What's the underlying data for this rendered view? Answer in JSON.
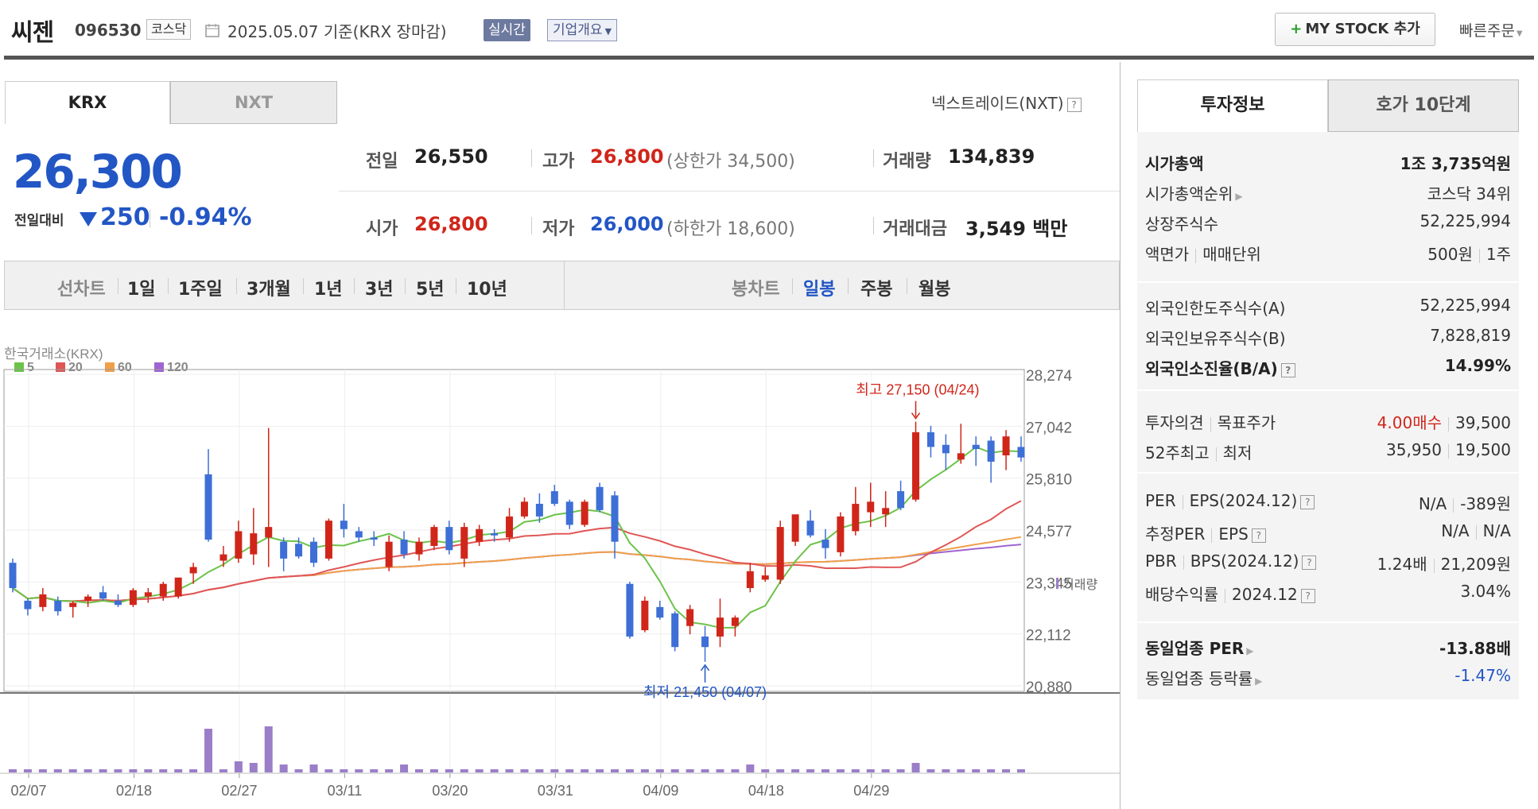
{
  "header": {
    "name": "씨젠",
    "code": "096530",
    "market": "코스닥",
    "date": "2025.05.07  기준(KRX 장마감)",
    "realtime": "실시간",
    "corp_overview": "기업개요",
    "my_stock": "MY STOCK 추가",
    "quick_order": "빠른주문"
  },
  "exchange": {
    "tabs": [
      "KRX",
      "NXT"
    ],
    "nxt_link": "넥스트레이드(NXT)"
  },
  "quote": {
    "price": "26,300",
    "change_label": "전일대비",
    "change": "250",
    "change_pct": "-0.94%",
    "prev_label": "전일",
    "prev": "26,550",
    "high_label": "고가",
    "high": "26,800",
    "upper_limit": "(상한가 34,500)",
    "volume_label": "거래량",
    "volume": "134,839",
    "open_label": "시가",
    "open": "26,800",
    "low_label": "저가",
    "low": "26,000",
    "lower_limit": "(하한가 18,600)",
    "amount_label": "거래대금",
    "amount": "3,549 백만"
  },
  "chart_bar": {
    "line_label": "선차트",
    "line_periods": [
      "1일",
      "1주일",
      "3개월",
      "1년",
      "3년",
      "5년",
      "10년"
    ],
    "candle_label": "봉차트",
    "candle_periods": [
      "일봉",
      "주봉",
      "월봉"
    ],
    "selected": "일봉"
  },
  "chart_data": {
    "type": "candlestick",
    "source": "한국거래소(KRX)",
    "legend": [
      "5",
      "20",
      "60",
      "120"
    ],
    "ma_colors": [
      "#6cc34a",
      "#e05656",
      "#f0a04a",
      "#a064d2"
    ],
    "up_color": "#d0261a",
    "down_color": "#3d6fd6",
    "y_ticks": [
      28274,
      27042,
      25810,
      24577,
      23345,
      22112,
      20880
    ],
    "y_tick_labels": [
      "28,274",
      "27,042",
      "25,810",
      "24,577",
      "23,345",
      "22,112",
      "20,880"
    ],
    "ylim": [
      20880,
      28274
    ],
    "x_labels": [
      "02/07",
      "02/18",
      "02/27",
      "03/11",
      "03/20",
      "03/31",
      "04/09",
      "04/18",
      "04/29"
    ],
    "x_label_index": [
      0,
      7,
      14,
      21,
      28,
      35,
      42,
      49,
      56
    ],
    "max_annotation": "최고 27,150 (04/24)",
    "min_annotation": "최저 21,450 (04/07)",
    "volume_label": "거래량",
    "candles": [
      {
        "o": 23800,
        "h": 23900,
        "l": 23100,
        "c": 23200
      },
      {
        "o": 22900,
        "h": 22950,
        "l": 22550,
        "c": 22700
      },
      {
        "o": 22750,
        "h": 23200,
        "l": 22650,
        "c": 23050
      },
      {
        "o": 22900,
        "h": 23000,
        "l": 22550,
        "c": 22650
      },
      {
        "o": 22750,
        "h": 22900,
        "l": 22500,
        "c": 22850
      },
      {
        "o": 22900,
        "h": 23050,
        "l": 22750,
        "c": 23000
      },
      {
        "o": 23100,
        "h": 23250,
        "l": 22900,
        "c": 22950
      },
      {
        "o": 22900,
        "h": 23050,
        "l": 22750,
        "c": 22800
      },
      {
        "o": 22800,
        "h": 23200,
        "l": 22750,
        "c": 23150
      },
      {
        "o": 23000,
        "h": 23200,
        "l": 22850,
        "c": 23100
      },
      {
        "o": 23000,
        "h": 23350,
        "l": 22900,
        "c": 23300
      },
      {
        "o": 23000,
        "h": 23400,
        "l": 22950,
        "c": 23450
      },
      {
        "o": 23550,
        "h": 23800,
        "l": 23300,
        "c": 23700
      },
      {
        "o": 25900,
        "h": 26500,
        "l": 24300,
        "c": 24350
      },
      {
        "o": 23850,
        "h": 24200,
        "l": 23700,
        "c": 24000
      },
      {
        "o": 23900,
        "h": 24800,
        "l": 23800,
        "c": 24550
      },
      {
        "o": 24000,
        "h": 25100,
        "l": 23750,
        "c": 24500
      },
      {
        "o": 24400,
        "h": 27000,
        "l": 23700,
        "c": 24650
      },
      {
        "o": 24300,
        "h": 24400,
        "l": 23600,
        "c": 23900
      },
      {
        "o": 24250,
        "h": 24400,
        "l": 23900,
        "c": 23950
      },
      {
        "o": 24300,
        "h": 24400,
        "l": 23700,
        "c": 23800
      },
      {
        "o": 23900,
        "h": 24850,
        "l": 23850,
        "c": 24800
      },
      {
        "o": 24800,
        "h": 25200,
        "l": 24400,
        "c": 24600
      },
      {
        "o": 24550,
        "h": 24650,
        "l": 24300,
        "c": 24400
      },
      {
        "o": 24400,
        "h": 24550,
        "l": 24200,
        "c": 24350
      },
      {
        "o": 23700,
        "h": 24450,
        "l": 23600,
        "c": 24300
      },
      {
        "o": 24350,
        "h": 24550,
        "l": 23900,
        "c": 24000
      },
      {
        "o": 24000,
        "h": 24400,
        "l": 23850,
        "c": 24300
      },
      {
        "o": 24200,
        "h": 24700,
        "l": 24100,
        "c": 24650
      },
      {
        "o": 24650,
        "h": 24800,
        "l": 24000,
        "c": 24100
      },
      {
        "o": 23900,
        "h": 24750,
        "l": 23700,
        "c": 24650
      },
      {
        "o": 24300,
        "h": 24700,
        "l": 24200,
        "c": 24600
      },
      {
        "o": 24500,
        "h": 24600,
        "l": 24300,
        "c": 24450
      },
      {
        "o": 24400,
        "h": 25100,
        "l": 24300,
        "c": 24900
      },
      {
        "o": 24900,
        "h": 25350,
        "l": 24850,
        "c": 25250
      },
      {
        "o": 25200,
        "h": 25450,
        "l": 24750,
        "c": 24900
      },
      {
        "o": 25500,
        "h": 25650,
        "l": 25150,
        "c": 25200
      },
      {
        "o": 25250,
        "h": 25300,
        "l": 24600,
        "c": 24700
      },
      {
        "o": 24700,
        "h": 25300,
        "l": 24650,
        "c": 25250
      },
      {
        "o": 25600,
        "h": 25700,
        "l": 25000,
        "c": 25050
      },
      {
        "o": 25400,
        "h": 25500,
        "l": 23900,
        "c": 24300
      },
      {
        "o": 23300,
        "h": 23350,
        "l": 22000,
        "c": 22050
      },
      {
        "o": 22200,
        "h": 23000,
        "l": 22150,
        "c": 22900
      },
      {
        "o": 22750,
        "h": 22900,
        "l": 22450,
        "c": 22500
      },
      {
        "o": 22600,
        "h": 22650,
        "l": 21700,
        "c": 21800
      },
      {
        "o": 22300,
        "h": 22800,
        "l": 22100,
        "c": 22700
      },
      {
        "o": 22050,
        "h": 22300,
        "l": 21450,
        "c": 21800
      },
      {
        "o": 22050,
        "h": 22950,
        "l": 21800,
        "c": 22500
      },
      {
        "o": 22300,
        "h": 22550,
        "l": 22050,
        "c": 22500
      },
      {
        "o": 23200,
        "h": 23800,
        "l": 23100,
        "c": 23600
      },
      {
        "o": 23400,
        "h": 23700,
        "l": 23350,
        "c": 23500
      },
      {
        "o": 23400,
        "h": 24800,
        "l": 23300,
        "c": 24650
      },
      {
        "o": 24300,
        "h": 24900,
        "l": 24200,
        "c": 24950
      },
      {
        "o": 24800,
        "h": 25050,
        "l": 24400,
        "c": 24450
      },
      {
        "o": 24350,
        "h": 24600,
        "l": 23900,
        "c": 24150
      },
      {
        "o": 24050,
        "h": 25000,
        "l": 23950,
        "c": 24900
      },
      {
        "o": 24550,
        "h": 25600,
        "l": 24450,
        "c": 25200
      },
      {
        "o": 25000,
        "h": 25700,
        "l": 24650,
        "c": 25250
      },
      {
        "o": 24950,
        "h": 25500,
        "l": 24650,
        "c": 25100
      },
      {
        "o": 25500,
        "h": 25750,
        "l": 25050,
        "c": 25100
      },
      {
        "o": 25300,
        "h": 27150,
        "l": 25250,
        "c": 26900
      },
      {
        "o": 26900,
        "h": 27050,
        "l": 26300,
        "c": 26550
      },
      {
        "o": 26600,
        "h": 26850,
        "l": 26000,
        "c": 26400
      },
      {
        "o": 26250,
        "h": 27100,
        "l": 26150,
        "c": 26400
      },
      {
        "o": 26600,
        "h": 26800,
        "l": 26100,
        "c": 26500
      },
      {
        "o": 26700,
        "h": 26800,
        "l": 25700,
        "c": 26200
      },
      {
        "o": 26350,
        "h": 26950,
        "l": 26000,
        "c": 26800
      },
      {
        "o": 26550,
        "h": 26800,
        "l": 26200,
        "c": 26300
      }
    ]
  },
  "invest": {
    "tabs": [
      "투자정보",
      "호가 10단계"
    ],
    "rows1": [
      {
        "k": "시가총액",
        "v": "1조 3,735억원"
      },
      {
        "k": "시가총액순위",
        "v": "코스닥 34위"
      },
      {
        "k": "상장주식수",
        "v": "52,225,994"
      },
      {
        "k1": "액면가",
        "k2": "매매단위",
        "v1": "500원",
        "v2": "1주"
      }
    ],
    "rows2": [
      {
        "k": "외국인한도주식수(A)",
        "v": "52,225,994"
      },
      {
        "k": "외국인보유주식수(B)",
        "v": "7,828,819"
      },
      {
        "k": "외국인소진율(B/A)",
        "v": "14.99%"
      }
    ],
    "opinion_k1": "투자의견",
    "opinion_k2": "목표주가",
    "opinion_v1": "4.00매수",
    "opinion_v2": "39,500",
    "w52_k1": "52주최고",
    "w52_k2": "최저",
    "w52_v1": "35,950",
    "w52_v2": "19,500",
    "per_k1": "PER",
    "per_k2": "EPS(2024.12)",
    "per_v1": "N/A",
    "per_v2": "-389원",
    "eper_k1": "추정PER",
    "eper_k2": "EPS",
    "eper_v1": "N/A",
    "eper_v2": "N/A",
    "pbr_k1": "PBR",
    "pbr_k2": "BPS(2024.12)",
    "pbr_v1": "1.24배",
    "pbr_v2": "21,209원",
    "div_k1": "배당수익률",
    "div_k2": "2024.12",
    "div_v": "3.04%",
    "ind_per_k": "동일업종 PER",
    "ind_per_v": "-13.88배",
    "ind_chg_k": "동일업종 등락률",
    "ind_chg_v": "-1.47%"
  }
}
